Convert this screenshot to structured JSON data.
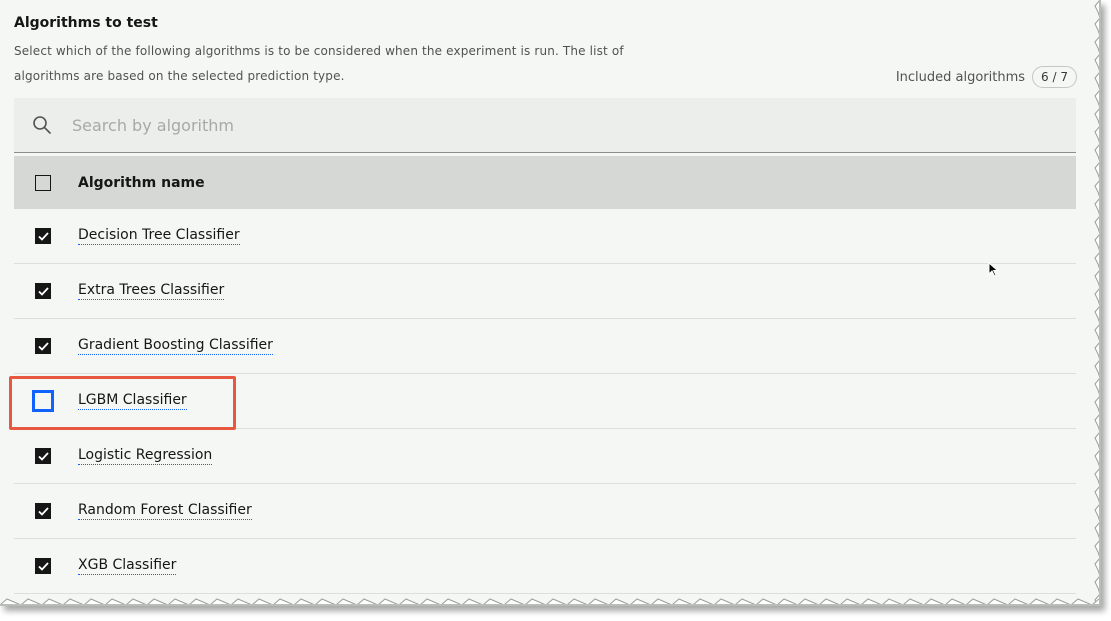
{
  "section": {
    "title": "Algorithms to test",
    "description": "Select which of the following algorithms is to be considered when the experiment is run. The list of algorithms are based on the selected prediction type."
  },
  "included": {
    "label": "Included algorithms",
    "count": "6 / 7"
  },
  "search": {
    "icon": "search-icon",
    "placeholder": "Search by algorithm"
  },
  "table": {
    "header": "Algorithm name",
    "rows": [
      {
        "name": "Decision Tree Classifier",
        "checked": true
      },
      {
        "name": "Extra Trees Classifier",
        "checked": true
      },
      {
        "name": "Gradient Boosting Classifier",
        "checked": true
      },
      {
        "name": "LGBM Classifier",
        "checked": false
      },
      {
        "name": "Logistic Regression",
        "checked": true
      },
      {
        "name": "Random Forest Classifier",
        "checked": true
      },
      {
        "name": "XGB Classifier",
        "checked": true
      }
    ]
  },
  "colors": {
    "focus": "#0f62fe",
    "highlight": "#e8573f",
    "checked": "#161616"
  }
}
